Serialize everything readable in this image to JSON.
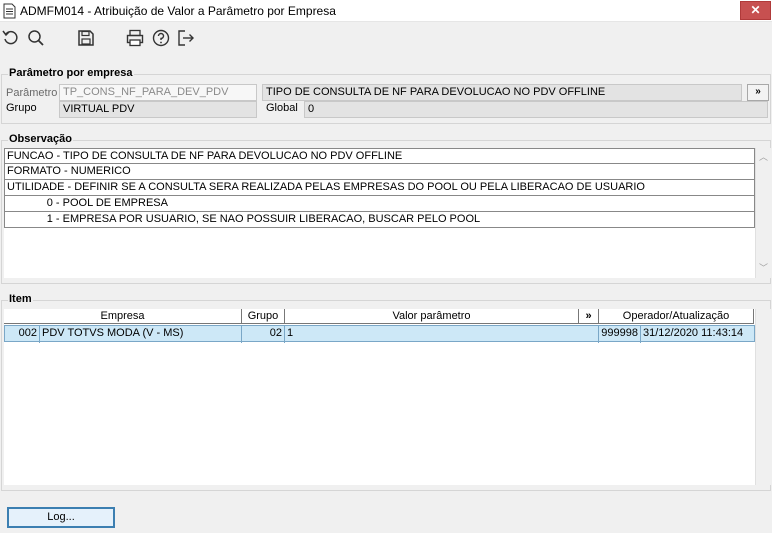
{
  "window": {
    "title": "ADMFM014 - Atribuição de Valor a Parâmetro por Empresa",
    "close_glyph": "✕"
  },
  "toolbar": {
    "icons": [
      "refresh-icon",
      "search-icon",
      "save-icon",
      "print-icon",
      "help-icon",
      "exit-icon"
    ]
  },
  "param_section": {
    "title": "Parâmetro por empresa",
    "parametro_label": "Parâmetro",
    "parametro_value": "TP_CONS_NF_PARA_DEV_PDV",
    "descricao_value": "TIPO DE CONSULTA DE NF PARA DEVOLUCAO NO PDV OFFLINE",
    "more_label": "»",
    "grupo_label": "Grupo",
    "grupo_value": "VIRTUAL PDV",
    "global_label": "Global",
    "global_value": "0"
  },
  "observacao": {
    "title": "Observação",
    "lines": [
      "FUNCAO - TIPO DE CONSULTA DE NF PARA DEVOLUCAO NO PDV OFFLINE",
      "FORMATO - NUMERICO",
      "UTILIDADE - DEFINIR SE A CONSULTA SERA REALIZADA PELAS EMPRESAS DO POOL OU PELA LIBERACAO DE USUARIO",
      "             0 - POOL DE EMPRESA",
      "             1 - EMPRESA POR USUARIO, SE NAO POSSUIR LIBERACAO, BUSCAR PELO POOL"
    ]
  },
  "item": {
    "title": "Item",
    "columns": {
      "empresa": "Empresa",
      "grupo": "Grupo",
      "valor": "Valor parâmetro",
      "more": "»",
      "operador": "Operador/Atualização"
    },
    "rows": [
      {
        "empresa_code": "002",
        "empresa_name": "PDV TOTVS MODA  (V - MS)",
        "grupo": "02",
        "valor": "1",
        "operador": "999998",
        "atualizacao": "31/12/2020 11:43:14"
      }
    ]
  },
  "footer": {
    "log_label": "Log..."
  }
}
